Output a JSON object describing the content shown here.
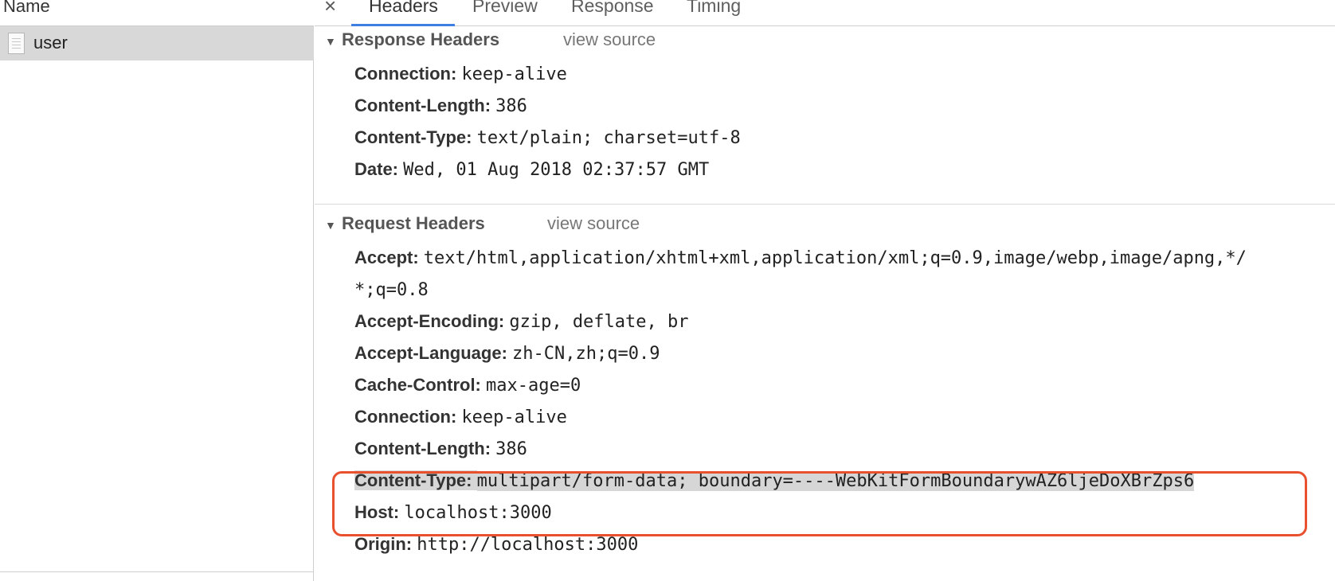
{
  "left_panel": {
    "column_header": "Name",
    "request": {
      "name": "user"
    }
  },
  "tabs": {
    "close_glyph": "×",
    "items": [
      "Headers",
      "Preview",
      "Response",
      "Timing"
    ],
    "active": "Headers"
  },
  "response_headers": {
    "title": "Response Headers",
    "view_source": "view source",
    "rows": [
      {
        "key": "Connection:",
        "value": "keep-alive"
      },
      {
        "key": "Content-Length:",
        "value": "386"
      },
      {
        "key": "Content-Type:",
        "value": "text/plain; charset=utf-8"
      },
      {
        "key": "Date:",
        "value": "Wed, 01 Aug 2018 02:37:57 GMT"
      }
    ]
  },
  "request_headers": {
    "title": "Request Headers",
    "view_source": "view source",
    "accept": {
      "key": "Accept:",
      "value_line1": "text/html,application/xhtml+xml,application/xml;q=0.9,image/webp,image/apng,*/",
      "value_line2": "*;q=0.8"
    },
    "rows": [
      {
        "key": "Accept-Encoding:",
        "value": "gzip, deflate, br"
      },
      {
        "key": "Accept-Language:",
        "value": "zh-CN,zh;q=0.9"
      },
      {
        "key": "Cache-Control:",
        "value": "max-age=0"
      },
      {
        "key": "Connection:",
        "value": "keep-alive"
      },
      {
        "key": "Content-Length:",
        "value": "386"
      },
      {
        "key": "Content-Type:",
        "value": "multipart/form-data; boundary=----WebKitFormBoundarywAZ6ljeDoXBrZps6"
      },
      {
        "key": "Host:",
        "value": "localhost:3000"
      },
      {
        "key": "Origin:",
        "value": "http://localhost:3000"
      }
    ]
  },
  "colors": {
    "accent_tab_underline": "#3d7fe0",
    "highlight_border": "#e8502e",
    "selected_row": "#d8d8d8"
  }
}
